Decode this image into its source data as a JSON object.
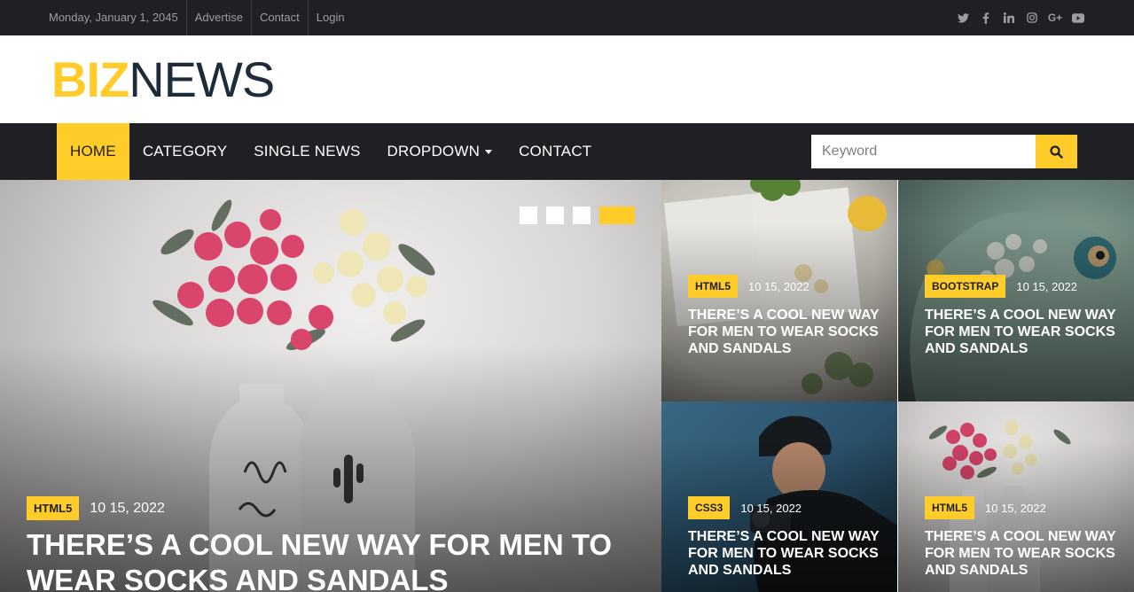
{
  "topbar": {
    "date": "Monday, January 1, 2045",
    "links": [
      "Advertise",
      "Contact",
      "Login"
    ],
    "social_icons": [
      "twitter-icon",
      "facebook-icon",
      "linkedin-icon",
      "instagram-icon",
      "google-plus-icon",
      "youtube-icon"
    ]
  },
  "logo": {
    "part1": "BIZ",
    "part2": "NEWS"
  },
  "nav": {
    "items": [
      "HOME",
      "CATEGORY",
      "SINGLE NEWS",
      "DROPDOWN",
      "CONTACT"
    ],
    "active": "HOME",
    "search_placeholder": "Keyword"
  },
  "hero": {
    "badge": "HTML5",
    "date": "10 15, 2022",
    "title": "THERE’S A COOL NEW WAY FOR MEN TO WEAR SOCKS AND SANDALS",
    "slides": 4,
    "active_slide": 4
  },
  "cards": [
    {
      "badge": "HTML5",
      "date": "10 15, 2022",
      "title": "THERE’S A COOL NEW WAY FOR MEN TO WEAR SOCKS AND SANDALS"
    },
    {
      "badge": "BOOTSTRAP",
      "date": "10 15, 2022",
      "title": "THERE’S A COOL NEW WAY FOR MEN TO WEAR SOCKS AND SANDALS"
    },
    {
      "badge": "CSS3",
      "date": "10 15, 2022",
      "title": "THERE’S A COOL NEW WAY FOR MEN TO WEAR SOCKS AND SANDALS"
    },
    {
      "badge": "HTML5",
      "date": "10 15, 2022",
      "title": "THERE’S A COOL NEW WAY FOR MEN TO WEAR SOCKS AND SANDALS"
    }
  ],
  "colors": {
    "accent": "#ffcc29",
    "dark": "#1e2024",
    "logo_dark": "#1e2b38"
  }
}
